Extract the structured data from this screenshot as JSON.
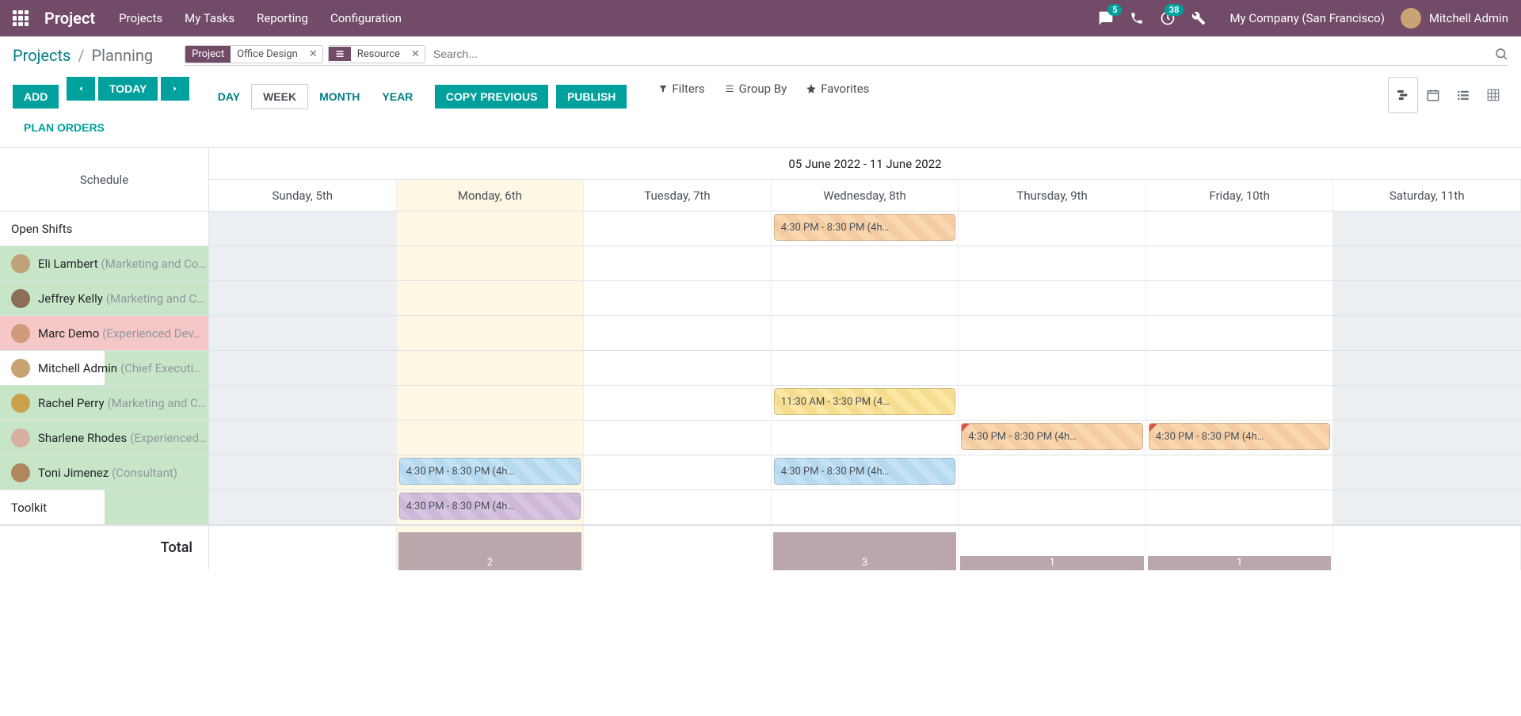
{
  "navbar": {
    "brand": "Project",
    "items": [
      "Projects",
      "My Tasks",
      "Reporting",
      "Configuration"
    ],
    "messaging_badge": "5",
    "activities_badge": "38",
    "company": "My Company (San Francisco)",
    "user_name": "Mitchell Admin"
  },
  "breadcrumb": {
    "parent": "Projects",
    "current": "Planning"
  },
  "search": {
    "facets": [
      {
        "label": "Project",
        "value": "Office Design"
      },
      {
        "icon": "groupby",
        "value": "Resource"
      }
    ],
    "placeholder": "Search..."
  },
  "buttons": {
    "add": "ADD",
    "today": "TODAY",
    "day": "DAY",
    "week": "WEEK",
    "month": "MONTH",
    "year": "YEAR",
    "copy_previous": "COPY PREVIOUS",
    "publish": "PUBLISH",
    "plan_orders": "PLAN ORDERS"
  },
  "search_options": {
    "filters": "Filters",
    "group_by": "Group By",
    "favorites": "Favorites"
  },
  "gantt": {
    "schedule_label": "Schedule",
    "date_range": "05 June 2022 - 11 June 2022",
    "days": [
      {
        "label": "Sunday, 5th",
        "weekend": true
      },
      {
        "label": "Monday, 6th",
        "today": true
      },
      {
        "label": "Tuesday, 7th"
      },
      {
        "label": "Wednesday, 8th"
      },
      {
        "label": "Thursday, 9th"
      },
      {
        "label": "Friday, 10th"
      },
      {
        "label": "Saturday, 11th",
        "weekend": true
      }
    ],
    "rows": [
      {
        "name": "Open Shifts",
        "role": "",
        "avatar": null,
        "bg": "",
        "pills": [
          {
            "day": 3,
            "text": "4:30 PM - 8:30 PM (4h…",
            "color": "orange"
          }
        ]
      },
      {
        "name": "Eli Lambert",
        "role": "(Marketing and Co…",
        "avatar": "#bfa27a",
        "bg": "green",
        "pills": []
      },
      {
        "name": "Jeffrey Kelly",
        "role": "(Marketing and C…",
        "avatar": "#8c6f56",
        "bg": "green",
        "pills": []
      },
      {
        "name": "Marc Demo",
        "role": "(Experienced Dev…",
        "avatar": "#d29a7a",
        "bg": "pink",
        "pills": []
      },
      {
        "name": "Mitchell Admin",
        "role": "(Chief Executi…",
        "avatar": "#c9a374",
        "bg": "green-partial",
        "pills": []
      },
      {
        "name": "Rachel Perry",
        "role": "(Marketing and C…",
        "avatar": "#caa24c",
        "bg": "green",
        "pills": [
          {
            "day": 3,
            "text": "11:30 AM - 3:30 PM (4…",
            "color": "yellow"
          }
        ]
      },
      {
        "name": "Sharlene Rhodes",
        "role": "(Experienced…",
        "avatar": "#d8b0a0",
        "bg": "green",
        "pills": [
          {
            "day": 4,
            "text": "4:30 PM - 8:30 PM (4h…",
            "color": "orange",
            "flag": true
          },
          {
            "day": 5,
            "text": "4:30 PM - 8:30 PM (4h…",
            "color": "orange",
            "flag": true
          }
        ]
      },
      {
        "name": "Toni Jimenez",
        "role": "(Consultant)",
        "avatar": "#b0875f",
        "bg": "green",
        "pills": [
          {
            "day": 1,
            "text": "4:30 PM - 8:30 PM (4h…",
            "color": "blue"
          },
          {
            "day": 3,
            "text": "4:30 PM - 8:30 PM (4h…",
            "color": "blue"
          }
        ]
      },
      {
        "name": "Toolkit",
        "role": "",
        "avatar": null,
        "bg": "green-partial",
        "pills": [
          {
            "day": 1,
            "text": "4:30 PM - 8:30 PM (4h…",
            "color": "purple"
          }
        ]
      }
    ],
    "total_label": "Total",
    "totals": [
      null,
      2,
      null,
      3,
      1,
      1,
      null
    ],
    "total_heights": [
      0,
      48,
      0,
      48,
      18,
      18,
      0
    ]
  }
}
